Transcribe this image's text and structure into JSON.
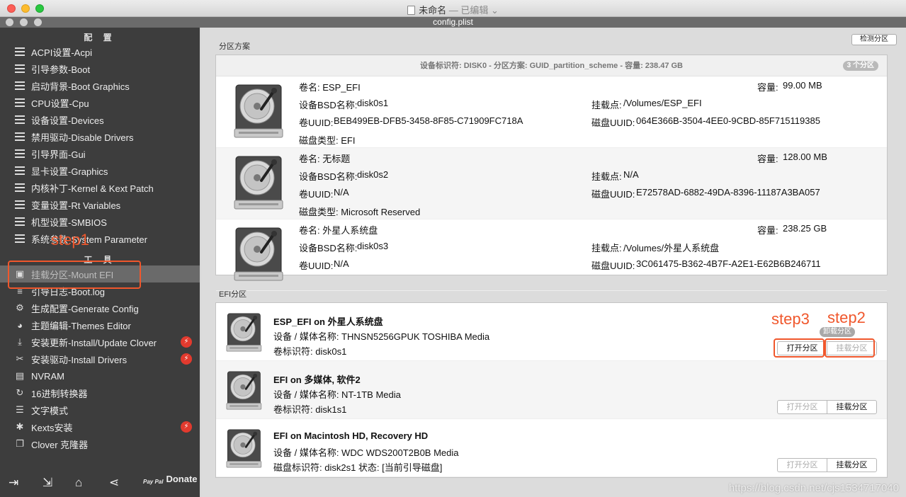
{
  "window": {
    "title": "未命名",
    "title_status": "— 已编辑",
    "subtitle": "config.plist"
  },
  "sidebar": {
    "config_header": "配 置",
    "tools_header": "工 具",
    "config_items": [
      {
        "label": "ACPI设置-Acpi",
        "icon": "list-icon"
      },
      {
        "label": "引导参数-Boot",
        "icon": "list-icon"
      },
      {
        "label": "启动背景-Boot Graphics",
        "icon": "list-icon"
      },
      {
        "label": "CPU设置-Cpu",
        "icon": "list-icon"
      },
      {
        "label": "设备设置-Devices",
        "icon": "list-icon"
      },
      {
        "label": "禁用驱动-Disable Drivers",
        "icon": "list-icon"
      },
      {
        "label": "引导界面-Gui",
        "icon": "list-icon"
      },
      {
        "label": "显卡设置-Graphics",
        "icon": "list-icon"
      },
      {
        "label": "内核补丁-Kernel & Kext Patch",
        "icon": "list-icon"
      },
      {
        "label": "变量设置-Rt Variables",
        "icon": "list-icon"
      },
      {
        "label": "机型设置-SMBIOS",
        "icon": "list-icon"
      },
      {
        "label": "系统参数-System Parameter",
        "icon": "list-icon"
      }
    ],
    "tool_items": [
      {
        "label": "挂载分区-Mount EFI",
        "icon": "disk-icon",
        "selected": true
      },
      {
        "label": "引导日志-Boot.log",
        "icon": "log-icon"
      },
      {
        "label": "生成配置-Generate Config",
        "icon": "gears-icon"
      },
      {
        "label": "主题编辑-Themes Editor",
        "icon": "palette-icon"
      },
      {
        "label": "安装更新-Install/Update Clover",
        "icon": "download-icon",
        "badge": "⚡"
      },
      {
        "label": "安装驱动-Install Drivers",
        "icon": "tools-icon",
        "badge": "⚡"
      },
      {
        "label": "NVRAM",
        "icon": "chip-icon"
      },
      {
        "label": "16进制转换器",
        "icon": "refresh-icon"
      },
      {
        "label": "文字模式",
        "icon": "text-icon"
      },
      {
        "label": "Kexts安装",
        "icon": "puzzle-icon",
        "badge": "⚡"
      },
      {
        "label": "Clover 克隆器",
        "icon": "clone-icon"
      }
    ],
    "donate_label": "Donate",
    "paypal_label": "Pay Pal"
  },
  "main": {
    "partition_scheme_label": "分区方案",
    "detect_button": "检测分区",
    "disk_header": "设备标识符: DISK0 - 分区方案: GUID_partition_scheme - 容量: 238.47 GB",
    "partition_count": "3 个分区",
    "partitions": [
      {
        "volume_name": "卷名: ESP_EFI",
        "capacity_label": "容量:",
        "capacity": "99.00 MB",
        "bsd_label": "设备BSD名称:",
        "bsd": "disk0s1",
        "mount_label": "挂载点:",
        "mount": "/Volumes/ESP_EFI",
        "vol_uuid_label": "卷UUID:",
        "vol_uuid": "BEB499EB-DFB5-3458-8F85-C71909FC718A",
        "disk_uuid_label": "磁盘UUID:",
        "disk_uuid": "064E366B-3504-4EE0-9CBD-85F715119385",
        "type": "磁盘类型: EFI"
      },
      {
        "volume_name": "卷名: 无标题",
        "capacity_label": "容量:",
        "capacity": "128.00 MB",
        "bsd_label": "设备BSD名称:",
        "bsd": "disk0s2",
        "mount_label": "挂载点:",
        "mount": "N/A",
        "vol_uuid_label": "卷UUID:",
        "vol_uuid": "N/A",
        "disk_uuid_label": "磁盘UUID:",
        "disk_uuid": "E72578AD-6882-49DA-8396-11187A3BA057",
        "type": "磁盘类型: Microsoft Reserved"
      },
      {
        "volume_name": "卷名: 外星人系统盘",
        "capacity_label": "容量:",
        "capacity": "238.25 GB",
        "bsd_label": "设备BSD名称:",
        "bsd": "disk0s3",
        "mount_label": "挂载点:",
        "mount": "/Volumes/外星人系统盘",
        "vol_uuid_label": "卷UUID:",
        "vol_uuid": "N/A",
        "disk_uuid_label": "磁盘UUID:",
        "disk_uuid": "3C061475-B362-4B7F-A2E1-E62B6B246711",
        "type": ""
      }
    ],
    "efi_label": "EFI分区",
    "efi_items": [
      {
        "title": "ESP_EFI on 外星人系统盘",
        "media": "设备 / 媒体名称: THNSN5256GPUK TOSHIBA Media",
        "identifier": "卷标识符: disk0s1",
        "open_button": "打开分区",
        "mount_button": "挂载分区",
        "tooltip": "卸载分区"
      },
      {
        "title": "EFI on 多媒体, 软件2",
        "media": "设备 / 媒体名称: NT-1TB Media",
        "identifier": "卷标识符: disk1s1",
        "open_button": "打开分区",
        "mount_button": "挂载分区"
      },
      {
        "title": "EFI on Macintosh HD, Recovery HD",
        "media": "设备 / 媒体名称: WDC WDS200T2B0B Media",
        "identifier": "磁盘标识符: disk2s1 状态: [当前引导磁盘]",
        "open_button": "打开分区",
        "mount_button": "挂载分区"
      }
    ]
  },
  "annotations": {
    "step1": "step1",
    "step2": "step2",
    "step3": "step3",
    "color": "#f0572c"
  },
  "watermark": "https://blog.csdn.net/cjs1534717040"
}
